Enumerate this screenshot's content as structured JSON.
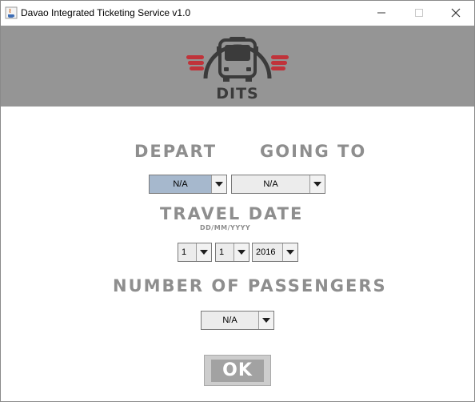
{
  "window": {
    "title": "Davao Integrated Ticketing Service v1.0",
    "controls": {
      "minimize": "—",
      "maximize": "☐",
      "close": "✕"
    }
  },
  "banner": {
    "logo_text": "DITS",
    "logo_icon": "bus-icon",
    "background": "#959595",
    "accent": "#c0333a"
  },
  "labels": {
    "depart": "DEPART",
    "going_to": "GOING TO",
    "travel_date": "TRAVEL DATE",
    "date_format": "DD/MM/YYYY",
    "number_of_passengers": "NUMBER OF PASSENGERS"
  },
  "fields": {
    "depart": "N/A",
    "going_to": "N/A",
    "day": "1",
    "month": "1",
    "year": "2016",
    "passengers": "N/A"
  },
  "buttons": {
    "ok": "OK"
  }
}
